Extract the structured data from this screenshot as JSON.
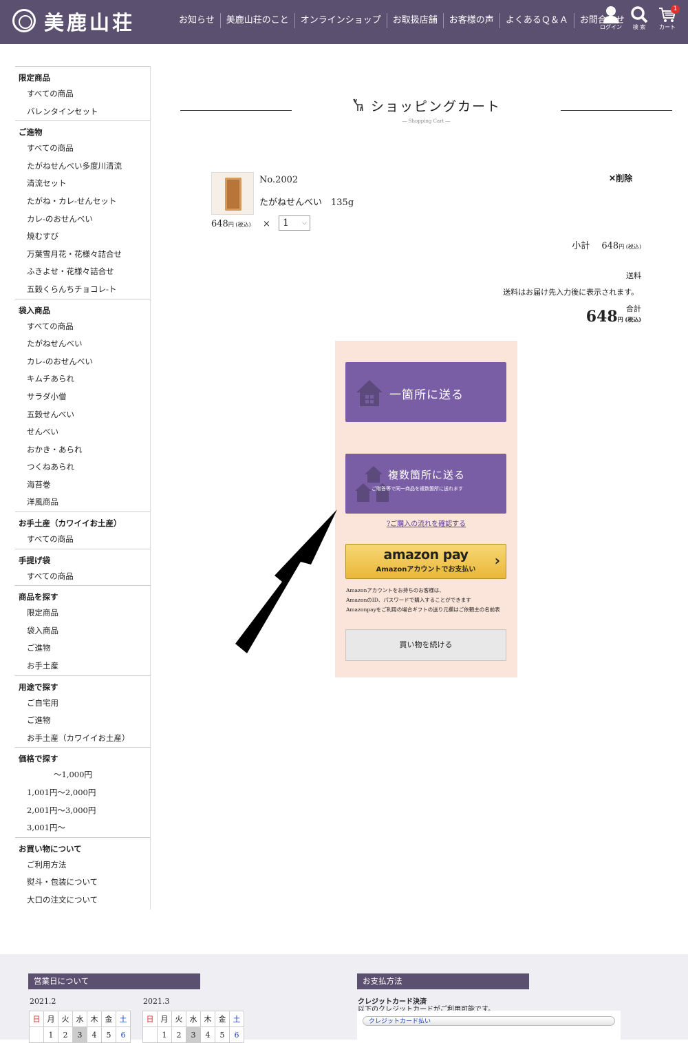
{
  "header": {
    "logo_text": "美鹿山荘",
    "nav": [
      "お知らせ",
      "美鹿山荘のこと",
      "オンラインショップ",
      "お取扱店舗",
      "お客様の声",
      "よくあるＱ＆Ａ",
      "お問合わせ"
    ],
    "login_label": "ログイン",
    "search_label": "検 索",
    "cart_label": "カート",
    "cart_count": "1"
  },
  "sidebar": {
    "categories": [
      {
        "title": "限定商品",
        "items": [
          "すべての商品",
          "バレンタインセット"
        ]
      },
      {
        "title": "ご進物",
        "items": [
          "すべての商品",
          "たがねせんべい多度川清流",
          "清流セット",
          "たがね・カレ-せんセット",
          "カレ-のおせんべい",
          "焼むすび",
          "万葉雪月花・花様々詰合せ",
          "ふきよせ・花様々詰合せ",
          "五穀くらんちチョコレ-ト"
        ]
      },
      {
        "title": "袋入商品",
        "items": [
          "すべての商品",
          "たがねせんべい",
          "カレ-のおせんべい",
          "キムチあられ",
          "サラダ小僧",
          "五穀せんべい",
          "せんべい",
          "おかき・あられ",
          "つくねあられ",
          "海苔巻",
          "洋風商品"
        ]
      },
      {
        "title": "お手土産（カワイイお土産）",
        "items": [
          "すべての商品"
        ]
      },
      {
        "title": "手提げ袋",
        "items": [
          "すべての商品"
        ]
      },
      {
        "title": "商品を探す",
        "items": [
          "限定商品",
          "袋入商品",
          "ご進物",
          "お手土産"
        ]
      },
      {
        "title": "用途で探す",
        "items": [
          "ご自宅用",
          "ご進物",
          "お手土産（カワイイお土産）"
        ]
      },
      {
        "title": "価格で探す",
        "items": [
          "〜1,000円",
          "1,001円〜2,000円",
          "2,001円〜3,000円",
          "3,001円〜"
        ]
      },
      {
        "title": "お買い物について",
        "items": [
          "ご利用方法",
          "熨斗・包装について",
          "大口の注文について"
        ]
      }
    ]
  },
  "page": {
    "title": "ショッピングカート",
    "subtitle": "― Shopping Cart ―"
  },
  "cart": {
    "item_no": "No.2002",
    "item_name": "たがねせんべい　135g",
    "price": "648",
    "yen_tax": "円 (税込)",
    "times": "×",
    "qty": "1",
    "delete_label": "削除",
    "subtotal_label": "小計",
    "subtotal_value": "648",
    "shipping_label": "送料",
    "shipping_note": "送料はお届け先入力後に表示されます。",
    "total_label": "合計",
    "total_value": "648"
  },
  "checkout": {
    "single_label": "一箇所に送る",
    "multi_label": "複数箇所に送る",
    "multi_sub": "ご贈答等で同一商品を複数箇所に送れます",
    "flow_link": "?ご購入の流れを確認する",
    "amazon_logo": "amazon pay",
    "amazon_sub": "Amazonアカウントでお支払い",
    "amazon_notes": [
      "Amazonアカウントをお持ちのお客様は、",
      "AmazonのID、パスワードで購入することができます",
      "Amazonpayをご利用の場合ギフトの送り元欄はご依頼主の名前表"
    ],
    "continue_label": "買い物を続ける"
  },
  "footer": {
    "business_title": "営業日について",
    "payment_title": "お支払方法",
    "cal1_month": "2021.2",
    "cal2_month": "2021.3",
    "weekdays": [
      "日",
      "月",
      "火",
      "水",
      "木",
      "金",
      "土"
    ],
    "cal1_row1": [
      "",
      "1",
      "2",
      "3",
      "4",
      "5",
      "6"
    ],
    "cal2_row1": [
      "",
      "1",
      "2",
      "3",
      "4",
      "5",
      "6"
    ],
    "credit_title": "クレジットカード決済",
    "credit_note": "以下のクレジットカードがご利用可能です。",
    "credit_tab": "クレジットカード払い"
  }
}
